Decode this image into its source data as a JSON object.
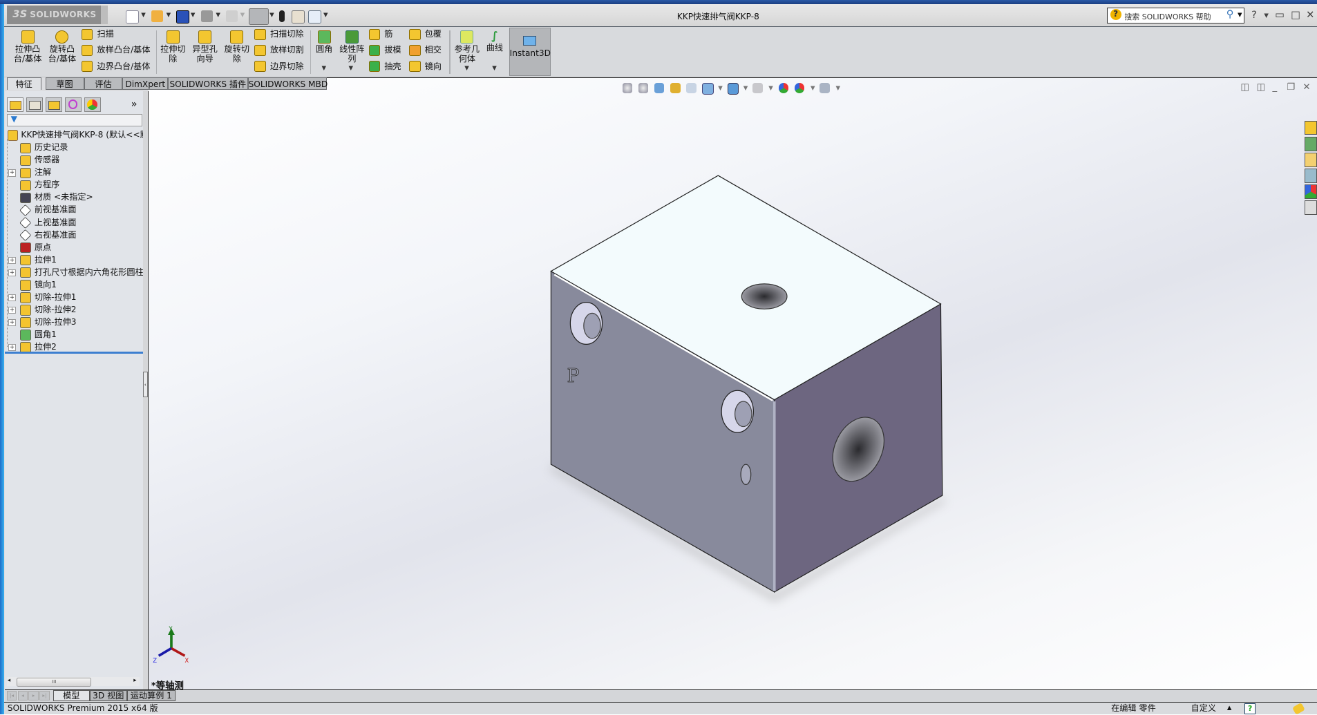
{
  "app": {
    "logo": "SOLIDWORKS",
    "title": "KKP快速排气阀KKP-8"
  },
  "titlebar": {
    "quick_access": [
      "new-document-icon",
      "open-icon",
      "save-icon",
      "print-icon",
      "undo-icon",
      "select-icon",
      "rebuild-icon",
      "file-properties-icon",
      "options-icon"
    ],
    "search_placeholder": "搜索 SOLIDWORKS 帮助",
    "help": "?",
    "minimize": "▭",
    "maximize": "□",
    "close": "✕"
  },
  "ribbon": {
    "extrude_boss": "拉伸凸\n台/基体",
    "revolve_boss": "旋转凸\n台/基体",
    "sweep": "扫描",
    "loft": "放样凸台/基体",
    "boundary": "边界凸台/基体",
    "extrude_cut": "拉伸切\n除",
    "hole_wizard": "异型孔\n向导",
    "revolve_cut": "旋转切\n除",
    "sweep_cut": "扫描切除",
    "loft_cut": "放样切割",
    "boundary_cut": "边界切除",
    "fillet": "圆角",
    "linear_pattern": "线性阵\n列",
    "rib": "筋",
    "draft": "拔模",
    "shell": "抽壳",
    "wrap": "包覆",
    "intersect": "相交",
    "mirror": "镜向",
    "ref_geometry": "参考几\n何体",
    "curves": "曲线",
    "instant3d": "Instant3D"
  },
  "tabs": [
    "特征",
    "草图",
    "评估",
    "DimXpert",
    "SOLIDWORKS 插件",
    "SOLIDWORKS MBD"
  ],
  "active_tab": "特征",
  "feature_manager": {
    "panel_tabs": [
      "featuremanager-icon",
      "propertymanager-icon",
      "configurationmanager-icon",
      "dimxpert-icon",
      "display-manager-icon"
    ],
    "more": "»",
    "root": "KKP快速排气阀KKP-8  (默认<<默",
    "items": [
      {
        "label": "历史记录",
        "icon": "history-icon",
        "expand": false,
        "color": "#f4c430"
      },
      {
        "label": "传感器",
        "icon": "sensor-icon",
        "expand": false,
        "color": "#f4c430"
      },
      {
        "label": "注解",
        "icon": "annotations-icon",
        "expand": true,
        "color": "#f4c430"
      },
      {
        "label": "方程序",
        "icon": "equations-icon",
        "expand": false,
        "color": "#f4c430"
      },
      {
        "label": "材质 <未指定>",
        "icon": "material-icon",
        "expand": false,
        "color": "#445"
      },
      {
        "label": "前视基准面",
        "icon": "plane-icon",
        "expand": false,
        "color": "#fff"
      },
      {
        "label": "上视基准面",
        "icon": "plane-icon",
        "expand": false,
        "color": "#fff"
      },
      {
        "label": "右视基准面",
        "icon": "plane-icon",
        "expand": false,
        "color": "#fff"
      },
      {
        "label": "原点",
        "icon": "origin-icon",
        "expand": false,
        "color": "#b22"
      },
      {
        "label": "拉伸1",
        "icon": "extrude-icon",
        "expand": true,
        "color": "#f4c430"
      },
      {
        "label": "打孔尺寸根据内六角花形圆柱",
        "icon": "hole-wizard-icon",
        "expand": true,
        "color": "#f4c430"
      },
      {
        "label": "镜向1",
        "icon": "mirror-icon",
        "expand": false,
        "color": "#f4c430"
      },
      {
        "label": "切除-拉伸1",
        "icon": "cut-extrude-icon",
        "expand": true,
        "color": "#f4c430"
      },
      {
        "label": "切除-拉伸2",
        "icon": "cut-extrude-icon",
        "expand": true,
        "color": "#f4c430"
      },
      {
        "label": "切除-拉伸3",
        "icon": "cut-extrude-icon",
        "expand": true,
        "color": "#f4c430"
      },
      {
        "label": "圆角1",
        "icon": "fillet-icon",
        "expand": false,
        "color": "#5cb85c"
      },
      {
        "label": "拉伸2",
        "icon": "extrude-icon",
        "expand": true,
        "color": "#f4c430"
      }
    ],
    "scroll_thumb": "III"
  },
  "viewport": {
    "view_name": "*等轴测",
    "triad": {
      "x": "X",
      "y": "Y",
      "z": "Z"
    },
    "part_label": "P",
    "colors": {
      "top": "#f3fbfd",
      "left": "#888a9c",
      "right": "#6d6680"
    }
  },
  "bottom_tabs": [
    "模型",
    "3D 视图",
    "运动算例 1"
  ],
  "status": {
    "product": "SOLIDWORKS Premium 2015 x64 版",
    "mode": "在编辑 零件",
    "units": "自定义",
    "help": "?"
  }
}
